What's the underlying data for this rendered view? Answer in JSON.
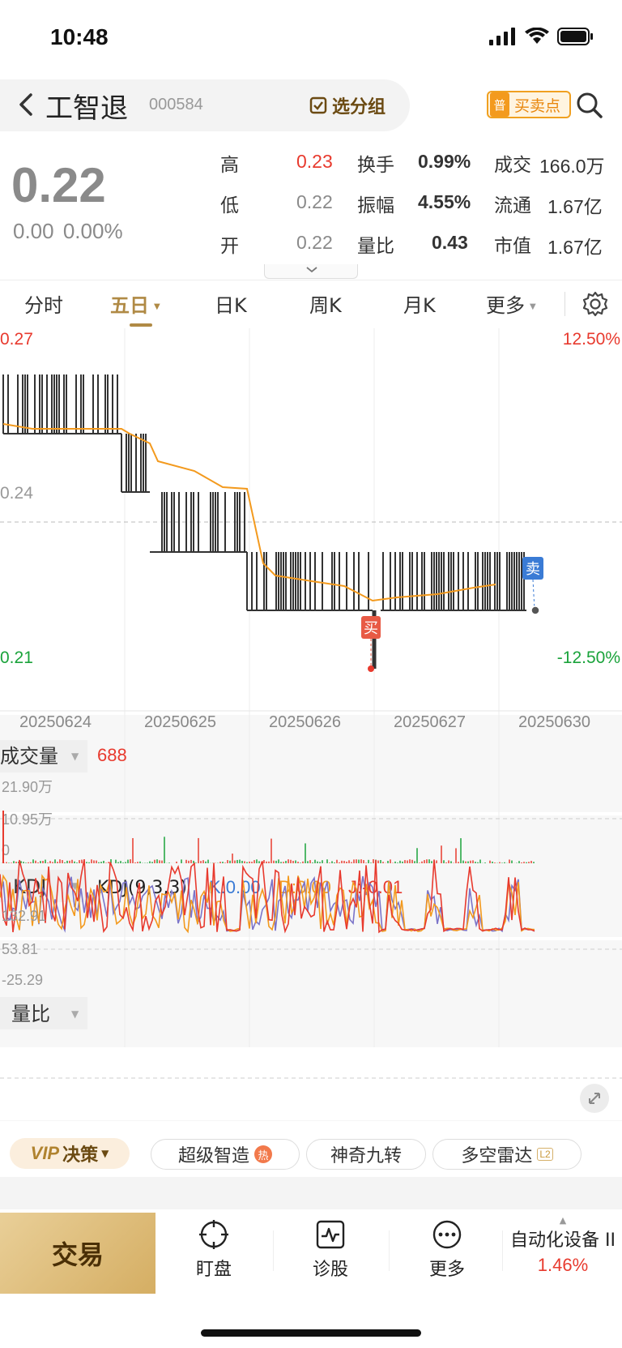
{
  "status_bar": {
    "time": "10:48"
  },
  "header": {
    "stock_name": "工智退",
    "stock_code": "000584",
    "group_button": "选分组",
    "bs_badge": "普",
    "bs_label": "买卖点"
  },
  "quote": {
    "price": "0.22",
    "change": "0.00",
    "change_pct": "0.00%",
    "stats": [
      {
        "label": "高",
        "value": "0.23",
        "color": "#e83a2e"
      },
      {
        "label": "低",
        "value": "0.22",
        "color": "#8a8a8a"
      },
      {
        "label": "开",
        "value": "0.22",
        "color": "#8a8a8a"
      },
      {
        "label": "换手",
        "value": "0.99%"
      },
      {
        "label": "振幅",
        "value": "4.55%"
      },
      {
        "label": "量比",
        "value": "0.43"
      },
      {
        "label": "成交",
        "value": "166.0万"
      },
      {
        "label": "流通",
        "value": "1.67亿"
      },
      {
        "label": "市值",
        "value": "1.67亿"
      }
    ]
  },
  "tabs": [
    {
      "label": "分时"
    },
    {
      "label": "五日",
      "active": true
    },
    {
      "label": "日K"
    },
    {
      "label": "周K"
    },
    {
      "label": "月K"
    },
    {
      "label": "更多"
    }
  ],
  "chart": {
    "price_high": "0.27",
    "price_mid": "0.24",
    "price_low": "0.21",
    "pct_high": "12.50%",
    "pct_low": "-12.50%",
    "dates": [
      "20250624",
      "20250625",
      "20250626",
      "20250627",
      "20250630"
    ],
    "buy_marker": "买",
    "sell_marker": "卖",
    "volume_label": "成交量",
    "volume_value": "688",
    "volume_ticks": [
      "21.90万",
      "10.95万",
      "0"
    ],
    "kdj_label": "KDJ",
    "kdj_params": "KDJ(9,3,3)",
    "kdj_k": "K:0.00",
    "kdj_d": "D:0.00",
    "kdj_j": "J:-0.01",
    "kdj_ticks": [
      "132.91",
      "53.81",
      "-25.29"
    ],
    "ratio_label": "量比",
    "colors": {
      "up": "#e83a2e",
      "down": "#1aa33b",
      "avg_line": "#f39a1e",
      "k_line": "#7b74c9",
      "price_line": "#333333"
    }
  },
  "chart_data": {
    "type": "line",
    "x": [
      "20250624",
      "20250625",
      "20250626",
      "20250627",
      "20250630"
    ],
    "series": [],
    "ylim": [
      0.21,
      0.27
    ],
    "xlabel": "",
    "ylabel": ""
  },
  "features": {
    "vip": "VIP",
    "vip_label": "决策",
    "items": [
      "超级智造",
      "神奇九转",
      "多空雷达"
    ],
    "hot_badge": "热",
    "l2_badge": "L2"
  },
  "bottom_nav": {
    "trade": "交易",
    "items": [
      "盯盘",
      "诊股",
      "更多"
    ],
    "sector_name": "自动化设备 II",
    "sector_pct": "1.46%"
  }
}
